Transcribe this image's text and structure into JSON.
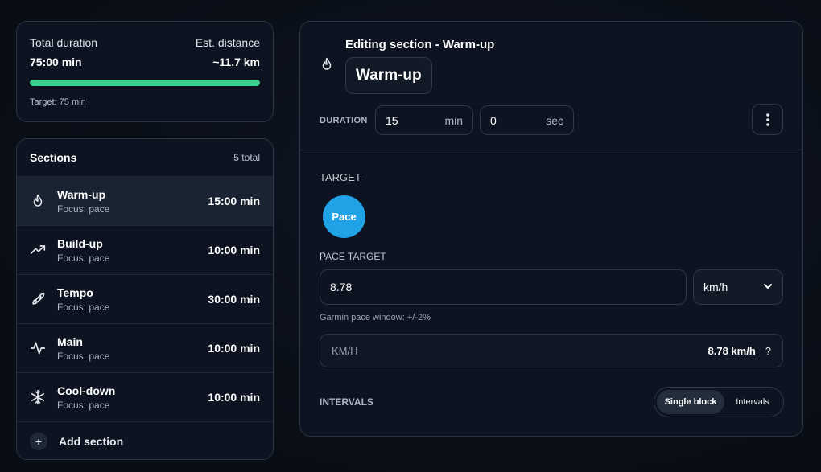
{
  "summary": {
    "total_duration_label": "Total duration",
    "total_duration_value": "75:00 min",
    "est_distance_label": "Est. distance",
    "est_distance_value": "~11.7 km",
    "progress_fraction": 1.0,
    "progress_color": "#3ecf8e",
    "target_text": "Target: 75 min"
  },
  "sections": {
    "title": "Sections",
    "count_text": "5 total",
    "items": [
      {
        "name": "Warm-up",
        "focus": "Focus: pace",
        "duration": "15:00 min",
        "icon": "flame-icon",
        "active": true
      },
      {
        "name": "Build-up",
        "focus": "Focus: pace",
        "duration": "10:00 min",
        "icon": "trending-up-icon",
        "active": false
      },
      {
        "name": "Tempo",
        "focus": "Focus: pace",
        "duration": "30:00 min",
        "icon": "rocket-icon",
        "active": false
      },
      {
        "name": "Main",
        "focus": "Focus: pace",
        "duration": "10:00 min",
        "icon": "activity-icon",
        "active": false
      },
      {
        "name": "Cool-down",
        "focus": "Focus: pace",
        "duration": "10:00 min",
        "icon": "snowflake-icon",
        "active": false
      }
    ],
    "add_label": "Add section",
    "add_symbol": "+"
  },
  "editor": {
    "heading": "Editing section - Warm-up",
    "section_name": "Warm-up",
    "duration_label": "DURATION",
    "duration_min_value": "15",
    "duration_min_unit": "min",
    "duration_sec_value": "0",
    "duration_sec_unit": "sec",
    "target_label": "TARGET",
    "target_option": "Pace",
    "target_color": "#1fa3e6",
    "pace_target_label": "PACE TARGET",
    "pace_value": "8.78",
    "pace_unit": "km/h",
    "window_note": "Garmin pace window: +/-2%",
    "kmh_label": "KM/H",
    "kmh_value": "8.78 km/h",
    "kmh_help": "?",
    "intervals_label": "INTERVALS",
    "interval_modes": [
      "Single block",
      "Intervals"
    ],
    "interval_selected": "Single block"
  }
}
